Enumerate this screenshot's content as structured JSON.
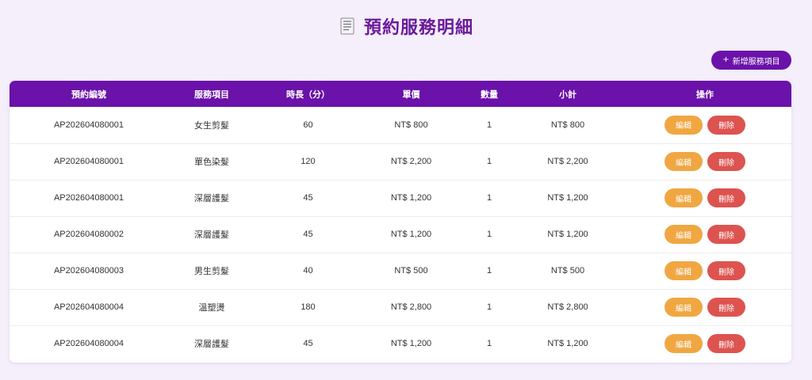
{
  "page": {
    "title": "預約服務明細",
    "title_icon": "receipt-icon",
    "add_button": {
      "icon": "+",
      "label": "新增服務項目"
    }
  },
  "colors": {
    "accent": "#6a12a9",
    "title": "#6a1b9a",
    "background": "#f5eefb",
    "edit_button": "#f0a742",
    "delete_button": "#dd534f"
  },
  "table": {
    "headers": [
      "預約編號",
      "服務項目",
      "時長（分）",
      "單價",
      "數量",
      "小計",
      "操作"
    ],
    "edit_label": "編輯",
    "delete_label": "刪除",
    "rows": [
      {
        "id": "AP202604080001",
        "service": "女生剪髮",
        "duration": "60",
        "price": "NT$ 800",
        "qty": "1",
        "subtotal": "NT$ 800"
      },
      {
        "id": "AP202604080001",
        "service": "單色染髮",
        "duration": "120",
        "price": "NT$ 2,200",
        "qty": "1",
        "subtotal": "NT$ 2,200"
      },
      {
        "id": "AP202604080001",
        "service": "深層護髮",
        "duration": "45",
        "price": "NT$ 1,200",
        "qty": "1",
        "subtotal": "NT$ 1,200"
      },
      {
        "id": "AP202604080002",
        "service": "深層護髮",
        "duration": "45",
        "price": "NT$ 1,200",
        "qty": "1",
        "subtotal": "NT$ 1,200"
      },
      {
        "id": "AP202604080003",
        "service": "男生剪髮",
        "duration": "40",
        "price": "NT$ 500",
        "qty": "1",
        "subtotal": "NT$ 500"
      },
      {
        "id": "AP202604080004",
        "service": "溫塑燙",
        "duration": "180",
        "price": "NT$ 2,800",
        "qty": "1",
        "subtotal": "NT$ 2,800"
      },
      {
        "id": "AP202604080004",
        "service": "深層護髮",
        "duration": "45",
        "price": "NT$ 1,200",
        "qty": "1",
        "subtotal": "NT$ 1,200"
      }
    ]
  }
}
